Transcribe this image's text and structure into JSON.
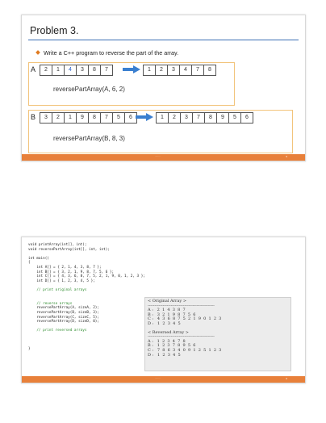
{
  "slide1": {
    "title": "Problem 3.",
    "bullet": "Write a C++ program to reverse the part of the array.",
    "arrayA": {
      "label": "A",
      "original": [
        "2",
        "1",
        "4",
        "3",
        "8",
        "7"
      ],
      "reversed": [
        "1",
        "2",
        "3",
        "4",
        "7",
        "8"
      ],
      "call": "reversePartArray(A, 6, 2)"
    },
    "arrayB": {
      "label": "B",
      "original": [
        "3",
        "2",
        "1",
        "9",
        "8",
        "7",
        "5",
        "6"
      ],
      "reversed": [
        "1",
        "2",
        "3",
        "7",
        "8",
        "9",
        "5",
        "6"
      ],
      "call": "reversePartArray(B, 8, 3)"
    },
    "footer_text": "········",
    "page_number": "5"
  },
  "slide2": {
    "code_lines": [
      "void printArray(int[], int);",
      "void reversePartArray(int[], int, int);",
      "",
      "int main()",
      "{",
      "    int A[] = { 2, 1, 4, 3, 8, 7 };",
      "    int B[] = { 3, 2, 1, 9, 8, 7, 5, 6 };",
      "    int C[] = { 4, 3, 6, 8, 7, 5, 2, 1, 9, 0, 1, 2, 3 };",
      "    int D[] = { 1, 2, 3, 4, 5 };",
      "",
      "    // print original arrays",
      "",
      "",
      "    // reverse arrays",
      "    reversePartArray(A, sizeA, 2);",
      "    reversePartArray(B, sizeB, 3);",
      "    reversePartArray(C, sizeC, 5);",
      "    reversePartArray(D, sizeD, 0);",
      "",
      "    // print reversed arrays",
      "",
      "",
      "",
      "}"
    ],
    "console_lines": [
      "< Original Array >",
      "-------------------------------------------------",
      "A :   2  1  4  3  8  7",
      "B :   3  2  1  9  8  7  5  6",
      "C :   4  3  6  8  7  5  2  1  9  0  1  2  3",
      "D :   1  2  3  4  5",
      "",
      "< Reversed Array >",
      "-------------------------------------------------",
      "A :   1  2  3  4  7  8",
      "B :   1  2  3  7  8  9  5  6",
      "C :   7  8  6  3  4  0  9  1  2  5  1  2  3",
      "D :   1  2  3  4  5",
      "",
      "",
      ""
    ],
    "footer_text": "········",
    "page_number": "6"
  }
}
